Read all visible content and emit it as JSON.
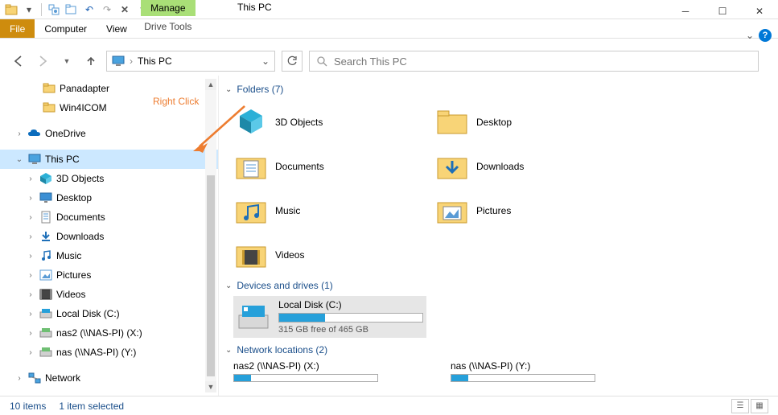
{
  "window": {
    "title": "This PC"
  },
  "ribbon": {
    "file": "File",
    "computer": "Computer",
    "view": "View",
    "manage": "Manage",
    "drive_tools": "Drive Tools"
  },
  "nav": {
    "address": "This PC",
    "search_placeholder": "Search This PC"
  },
  "tree": {
    "panadapter": "Panadapter",
    "win4icom": "Win4ICOM",
    "onedrive": "OneDrive",
    "thispc": "This PC",
    "3dobjects": "3D Objects",
    "desktop": "Desktop",
    "documents": "Documents",
    "downloads": "Downloads",
    "music": "Music",
    "pictures": "Pictures",
    "videos": "Videos",
    "localdisk": "Local Disk (C:)",
    "nas2": "nas2 (\\\\NAS-PI) (X:)",
    "nas": "nas (\\\\NAS-PI) (Y:)",
    "network": "Network"
  },
  "groups": {
    "folders": "Folders (7)",
    "devices": "Devices and drives (1)",
    "netloc": "Network locations (2)"
  },
  "content_folders": {
    "3dobjects": "3D Objects",
    "desktop": "Desktop",
    "documents": "Documents",
    "downloads": "Downloads",
    "music": "Music",
    "pictures": "Pictures",
    "videos": "Videos"
  },
  "drive": {
    "name": "Local Disk (C:)",
    "free": "315 GB free of 465 GB",
    "used_pct": 32
  },
  "net": {
    "nas2": "nas2 (\\\\NAS-PI) (X:)",
    "nas": "nas (\\\\NAS-PI) (Y:)"
  },
  "status": {
    "count": "10 items",
    "selected": "1 item selected"
  },
  "annotation": {
    "text": "Right Click"
  }
}
